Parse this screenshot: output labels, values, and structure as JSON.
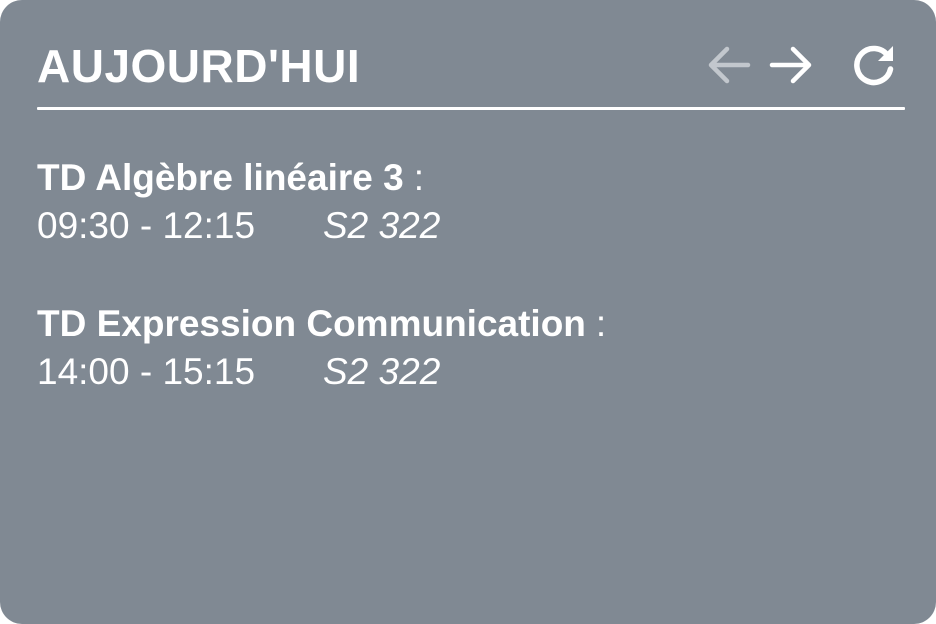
{
  "header": {
    "title": "AUJOURD'HUI",
    "icons": {
      "prev": "arrow-left-icon",
      "next": "arrow-right-icon",
      "refresh": "refresh-icon"
    }
  },
  "events": [
    {
      "name": "TD Algèbre linéaire 3",
      "separator": ":",
      "time": "09:30 - 12:15",
      "room": "S2 322"
    },
    {
      "name": "TD Expression Communication",
      "separator": ":",
      "time": "14:00 - 15:15",
      "room": "S2 322"
    }
  ],
  "colors": {
    "background": "#808993",
    "text": "#ffffff",
    "disabled_icon": "#c2c7cd"
  }
}
